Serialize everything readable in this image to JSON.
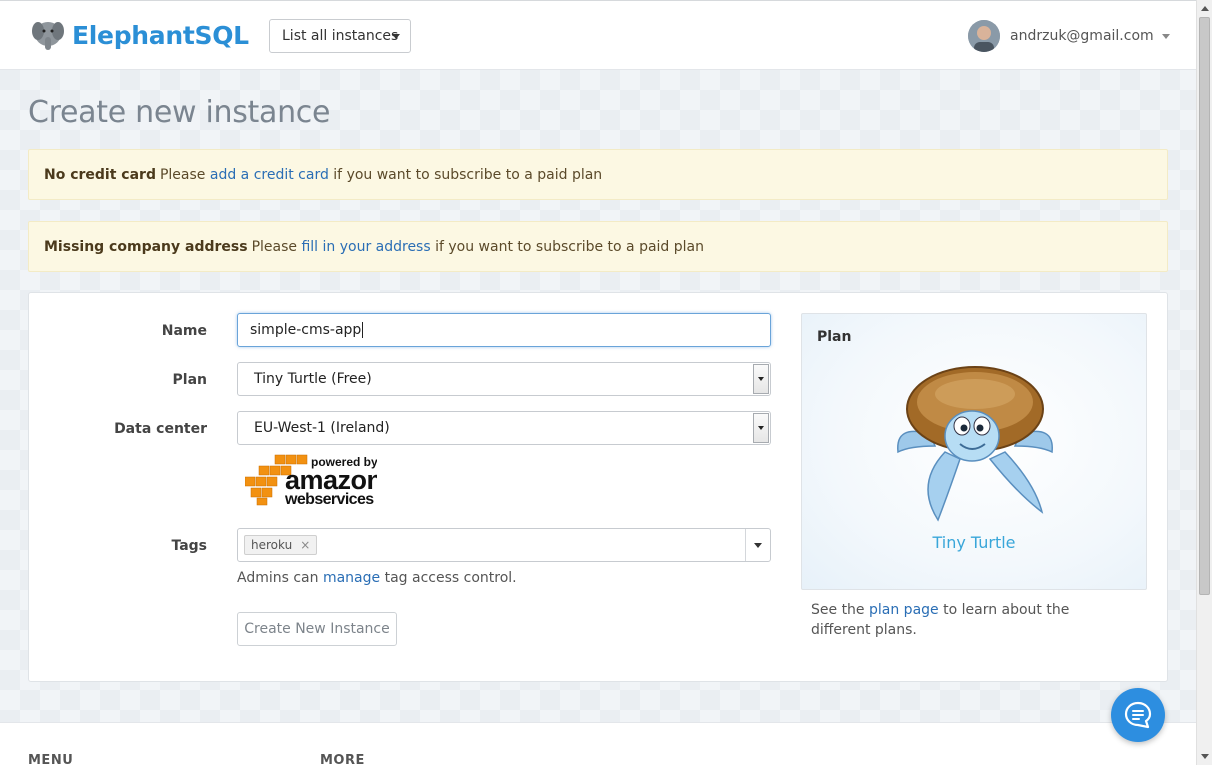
{
  "header": {
    "brand": "ElephantSQL",
    "instances_dropdown": "List all instances",
    "user_email": "andrzuk@gmail.com"
  },
  "page": {
    "title": "Create new instance"
  },
  "alerts": [
    {
      "strong": "No credit card",
      "before": "Please ",
      "link": "add a credit card",
      "after": " if you want to subscribe to a paid plan"
    },
    {
      "strong": "Missing company address",
      "before": "Please ",
      "link": "fill in your address",
      "after": " if you want to subscribe to a paid plan"
    }
  ],
  "form": {
    "name_label": "Name",
    "name_value": "simple-cms-app",
    "plan_label": "Plan",
    "plan_value": "Tiny Turtle (Free)",
    "datacenter_label": "Data center",
    "datacenter_value": "EU-West-1 (Ireland)",
    "aws_powered_by": "powered by",
    "aws_amazon": "amazon",
    "aws_webservices": "webservices",
    "tags_label": "Tags",
    "tags": [
      "heroku"
    ],
    "tag_remove": "×",
    "help_before": "Admins can ",
    "help_link": "manage",
    "help_after": " tag access control.",
    "submit_label": "Create New Instance"
  },
  "plan_card": {
    "title": "Plan",
    "plan_name": "Tiny Turtle",
    "note_before": "See the ",
    "note_link": "plan page",
    "note_after": " to learn about the different plans."
  },
  "footer": {
    "menu_heading": "MENU",
    "more_heading": "MORE"
  },
  "colors": {
    "brand": "#2b8fd6",
    "link": "#2a6eb5",
    "alert_bg": "#fcf8e3",
    "chat": "#2d8ee0"
  },
  "icons": {
    "logo": "elephant-icon",
    "chat": "chat-bubble-icon"
  }
}
